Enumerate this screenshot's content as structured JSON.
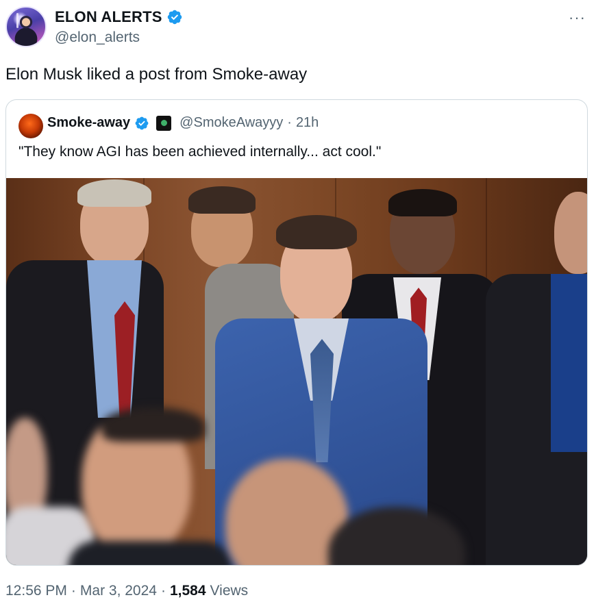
{
  "author": {
    "display_name": "ELON ALERTS",
    "handle": "@elon_alerts",
    "verified_icon": "verified-badge-icon",
    "more_label": "···"
  },
  "tweet": {
    "text": "Elon Musk liked a post from Smoke-away"
  },
  "quoted": {
    "display_name": "Smoke-away",
    "handle": "@SmokeAwayyy",
    "separator": "·",
    "time": "21h",
    "text": "\"They know AGI has been achieved internally... act cool.\"",
    "photo_icon": "photo"
  },
  "footer": {
    "time": "12:56 PM",
    "sep1": "·",
    "date": "Mar 3, 2024",
    "sep2": "·",
    "views_count": "1,584",
    "views_label": "Views"
  },
  "colors": {
    "verified_blue": "#1d9bf0",
    "muted_text": "#536471",
    "border": "#cfd9de"
  }
}
